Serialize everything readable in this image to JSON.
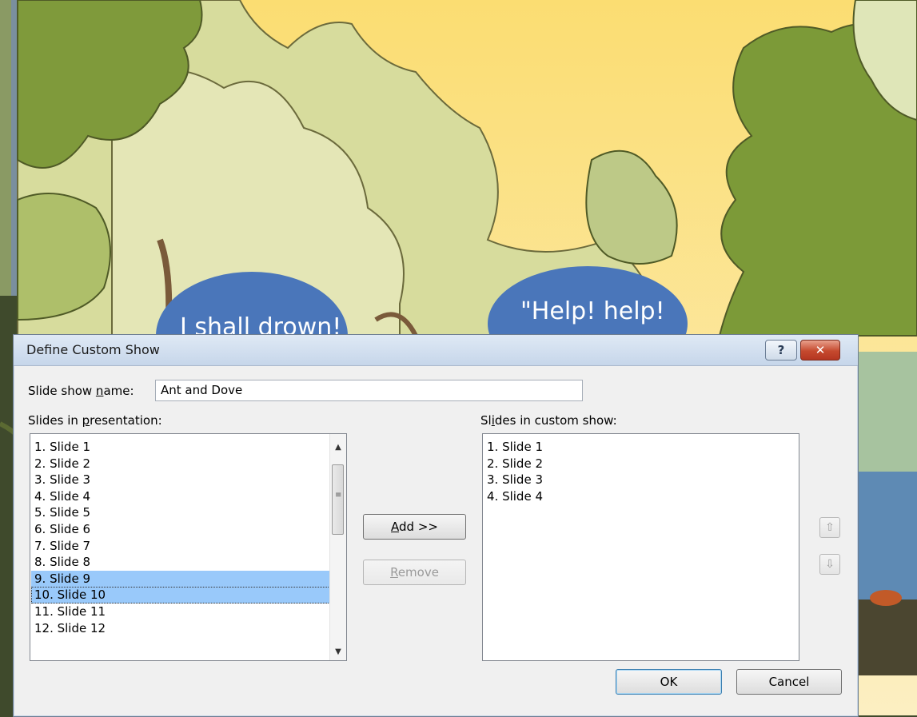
{
  "slide": {
    "bubble_left_text": "I shall drown!",
    "bubble_right_text": "\"Help! help!"
  },
  "dialog": {
    "title": "Define Custom Show",
    "help_icon": "question-mark-icon",
    "close_icon": "close-icon",
    "name_label_pre": "Slide show ",
    "name_label_accel": "n",
    "name_label_post": "ame:",
    "name_value": "Ant and Dove",
    "left_label_pre": "Slides in ",
    "left_label_accel": "p",
    "left_label_post": "resentation:",
    "right_label_pre": "Sl",
    "right_label_accel": "i",
    "right_label_post": "des in custom show:",
    "presentation_slides": [
      "1. Slide 1",
      "2. Slide 2",
      "3. Slide 3",
      "4. Slide 4",
      "5. Slide 5",
      "6. Slide 6",
      "7. Slide 7",
      "8. Slide 8",
      "9. Slide 9",
      "10. Slide 10",
      "11. Slide 11",
      "12. Slide 12"
    ],
    "selected_indices": [
      8,
      9
    ],
    "focused_index": 9,
    "custom_show_slides": [
      "1. Slide 1",
      "2. Slide 2",
      "3. Slide 3",
      "4. Slide 4"
    ],
    "add_accel": "A",
    "add_rest": "dd >>",
    "remove_accel": "R",
    "remove_rest": "emove",
    "ok_label": "OK",
    "cancel_label": "Cancel",
    "move_up_icon": "up-arrow-icon",
    "move_down_icon": "down-arrow-icon",
    "scroll_up_icon": "scroll-up-icon",
    "scroll_down_icon": "scroll-down-icon"
  },
  "colors": {
    "selection": "#99c9fa",
    "sky": "#fde79a",
    "tree_dark": "#7e9a3a",
    "tree_light": "#d4dc98",
    "bubble": "#4a76ba"
  }
}
